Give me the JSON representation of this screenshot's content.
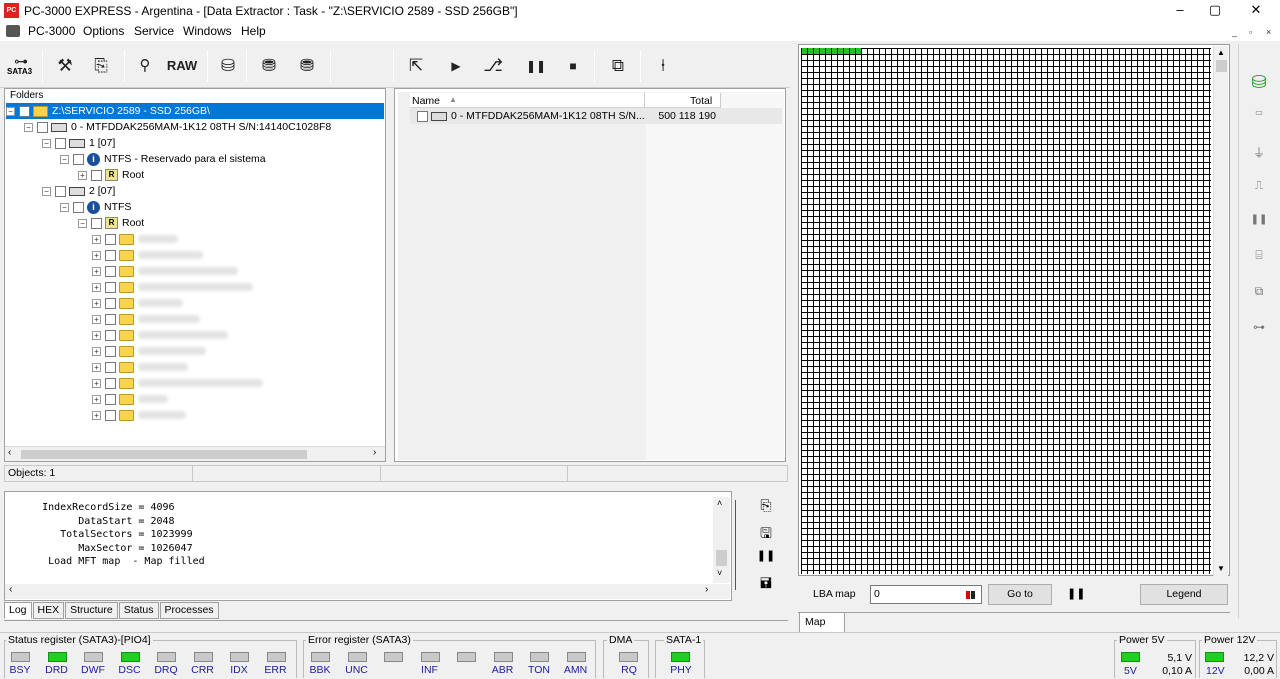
{
  "window": {
    "title": "PC-3000 EXPRESS - Argentina - [Data Extractor : Task - \"Z:\\SERVICIO 2589 - SSD 256GB\"]",
    "controls": [
      "–",
      "▢",
      "✕"
    ]
  },
  "menu": {
    "items": [
      "PC-3000",
      "Options",
      "Service",
      "Windows",
      "Help"
    ],
    "mdi_controls": [
      "_",
      "▫",
      "×"
    ]
  },
  "toolbar": {
    "sata_label": "SATA3",
    "raw_label": "RAW"
  },
  "tree": {
    "header": "Folders",
    "root": "Z:\\SERVICIO 2589 - SSD 256GB\\",
    "disk": "0 - MTFDDAK256MAM-1K12 08TH S/N:14140C1028F8",
    "partition1": "1 [07]",
    "ntfs1": "NTFS - Reservado para el sistema",
    "root1": "Root",
    "partition2": "2 [07]",
    "ntfs2": "NTFS",
    "root2": "Root"
  },
  "list": {
    "col_name": "Name",
    "col_total": "Total",
    "row_name": "0 - MTFDDAK256MAM-1K12 08TH S/N...",
    "row_total": "500 118 190"
  },
  "status": {
    "objects": "Objects: 1"
  },
  "log": {
    "lines": [
      "    IndexRecordSize = 4096",
      "          DataStart = 2048",
      "       TotalSectors = 1023999",
      "          MaxSector = 1026047",
      "     Load MFT map  - Map filled"
    ]
  },
  "bottom_tabs": [
    "Log",
    "HEX",
    "Structure",
    "Status",
    "Processes"
  ],
  "map": {
    "lba_label": "LBA map",
    "lba_value": "0",
    "goto_label": "Go to",
    "legend_label": "Legend",
    "tab_label": "Map"
  },
  "status_register": {
    "title": "Status register (SATA3)-[PIO4]",
    "leds": [
      {
        "label": "BSY",
        "on": false
      },
      {
        "label": "DRD",
        "on": true
      },
      {
        "label": "DWF",
        "on": false
      },
      {
        "label": "DSC",
        "on": true
      },
      {
        "label": "DRQ",
        "on": false
      },
      {
        "label": "CRR",
        "on": false
      },
      {
        "label": "IDX",
        "on": false
      },
      {
        "label": "ERR",
        "on": false
      }
    ]
  },
  "error_register": {
    "title": "Error register (SATA3)",
    "leds": [
      {
        "label": "BBK",
        "on": false
      },
      {
        "label": "UNC",
        "on": false
      },
      {
        "label": "",
        "on": false
      },
      {
        "label": "INF",
        "on": false
      },
      {
        "label": "",
        "on": false
      },
      {
        "label": "ABR",
        "on": false
      },
      {
        "label": "TON",
        "on": false
      },
      {
        "label": "AMN",
        "on": false
      }
    ]
  },
  "dma": {
    "title": "DMA",
    "label": "RQ",
    "on": false
  },
  "sata1": {
    "title": "SATA-1",
    "label": "PHY",
    "on": true
  },
  "power5": {
    "title": "Power 5V",
    "label": "5V",
    "voltage": "5,1 V",
    "current": "0,10 A",
    "on": true
  },
  "power12": {
    "title": "Power 12V",
    "label": "12V",
    "voltage": "12,2 V",
    "current": "0,00 A",
    "on": true
  },
  "colors": {
    "led_on": "#1fd11f",
    "selection": "#0078d7",
    "map_green": "#2dbb2d"
  }
}
